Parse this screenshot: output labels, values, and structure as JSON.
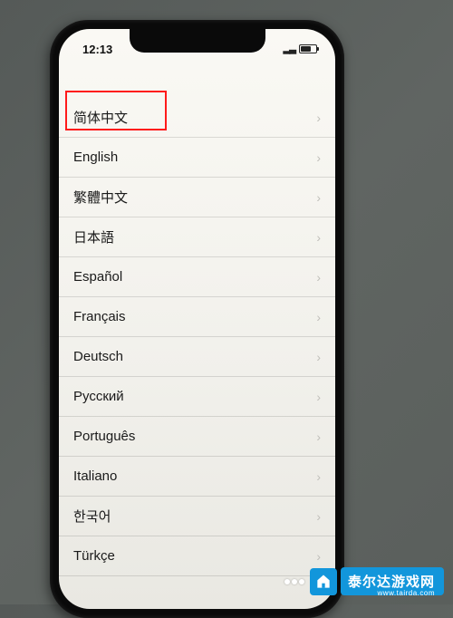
{
  "statusBar": {
    "time": "12:13"
  },
  "languages": {
    "items": [
      {
        "label": "简体中文"
      },
      {
        "label": "English"
      },
      {
        "label": "繁體中文"
      },
      {
        "label": "日本語"
      },
      {
        "label": "Español"
      },
      {
        "label": "Français"
      },
      {
        "label": "Deutsch"
      },
      {
        "label": "Русский"
      },
      {
        "label": "Português"
      },
      {
        "label": "Italiano"
      },
      {
        "label": "한국어"
      },
      {
        "label": "Türkçe"
      }
    ],
    "highlightedIndex": 0
  },
  "watermark": {
    "text": "泰尔达游戏网",
    "url": "www.tairda.com"
  }
}
